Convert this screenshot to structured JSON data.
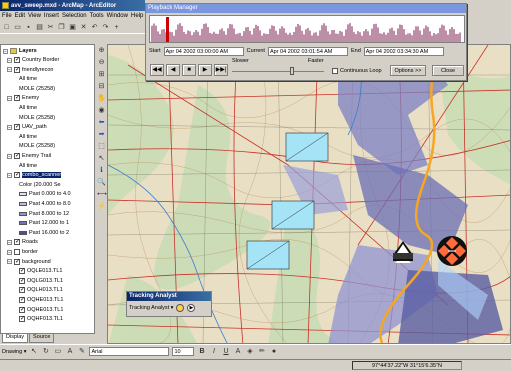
{
  "window": {
    "title": "avv_sweep.mxd - ArcMap - ArcEditor"
  },
  "menu": {
    "items": [
      "File",
      "Edit",
      "View",
      "Insert",
      "Selection",
      "Tools",
      "Window",
      "Help"
    ]
  },
  "toc": {
    "root": "Layers",
    "layers": [
      {
        "label": "Country Border",
        "checked": true
      },
      {
        "label": "friendlyrecon",
        "checked": true
      },
      {
        "label": "All time",
        "sub": true
      },
      {
        "label": "MOLE (25258)",
        "sub": true
      },
      {
        "label": "Enemy",
        "checked": true
      },
      {
        "label": "All time",
        "sub": true
      },
      {
        "label": "MOLE (25258)",
        "sub": true
      },
      {
        "label": "UAV_path",
        "checked": true
      },
      {
        "label": "All time",
        "sub": true
      },
      {
        "label": "MOLE (25258)",
        "sub": true
      },
      {
        "label": "Enemy Trail",
        "checked": true
      },
      {
        "label": "All time",
        "sub": true
      },
      {
        "label": "combo_scanner",
        "checked": true,
        "selected": true
      },
      {
        "label": "Color (20.000 Se",
        "sub": true
      },
      {
        "label": "Past 0.000 to 4.0",
        "sub": true,
        "swatch": "#dde0f4"
      },
      {
        "label": "Past 4.000 to 8.0",
        "sub": true,
        "swatch": "#b7bbe6"
      },
      {
        "label": "Past 8.000 to 12",
        "sub": true,
        "swatch": "#8f93d2"
      },
      {
        "label": "Past 12.000 to 1",
        "sub": true,
        "swatch": "#6f72b8"
      },
      {
        "label": "Past 16.000 to 2",
        "sub": true,
        "swatch": "#4b4e98"
      },
      {
        "label": "Roads",
        "checked": true
      },
      {
        "label": "border",
        "checked": false
      },
      {
        "label": "background",
        "checked": true
      },
      {
        "label": "OQLE013.TL1",
        "checked": true,
        "sub": true
      },
      {
        "label": "OQLG013.TL1",
        "checked": true,
        "sub": true
      },
      {
        "label": "OQLH013.TL1",
        "checked": true,
        "sub": true
      },
      {
        "label": "OQHE013.TL1",
        "checked": true,
        "sub": true
      },
      {
        "label": "OQHE013.TL1",
        "checked": true,
        "sub": true
      },
      {
        "label": "OQHF013.TL1",
        "checked": true,
        "sub": true
      }
    ],
    "tabs": [
      "Display",
      "Source"
    ]
  },
  "playback": {
    "title": "Playback Manager",
    "start_label": "Start",
    "start_value": "Apr 04 2002 03:00:00 AM",
    "current_label": "Current",
    "current_value": "Apr 04 2002 03:01:54 AM",
    "end_label": "End",
    "end_value": "Apr 04 2002 03:34:30 AM",
    "slower": "Slower",
    "faster": "Faster",
    "continuous_loop": "Continuous Loop",
    "options_btn": "Options >>",
    "close_btn": "Close",
    "transport": [
      "◀◀",
      "◀",
      "■",
      "▶",
      "▶▶|"
    ]
  },
  "tracking": {
    "title": "Tracking Analyst",
    "menu_label": "Tracking Analyst"
  },
  "drawbar": {
    "drawing_label": "Drawing",
    "font": "Arial",
    "size": "10",
    "text_icon": "A"
  },
  "status": {
    "coords": "97°44'37.22\"W  31°15'6.35\"N"
  },
  "colors": {
    "accent": "#0a246a",
    "route": "#f5a623",
    "scanner": "#6b6fb5"
  }
}
